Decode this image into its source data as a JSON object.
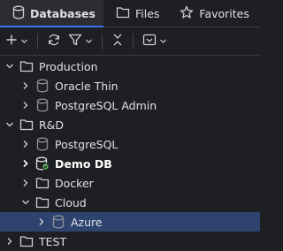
{
  "tabs": [
    {
      "label": "Databases",
      "icon": "database-icon",
      "active": true
    },
    {
      "label": "Files",
      "icon": "folder-icon",
      "active": false
    },
    {
      "label": "Favorites",
      "icon": "star-icon",
      "active": false
    }
  ],
  "toolbar": {
    "buttons": [
      "add-icon",
      "refresh-icon",
      "filter-icon",
      "collapse-all-icon",
      "view-options-icon"
    ]
  },
  "tree": [
    {
      "label": "Production",
      "icon": "folder-icon",
      "expanded": true,
      "depth": 0
    },
    {
      "label": "Oracle Thin",
      "icon": "database-icon",
      "expanded": false,
      "depth": 1
    },
    {
      "label": "PostgreSQL Admin",
      "icon": "database-icon",
      "expanded": false,
      "depth": 1
    },
    {
      "label": "R&D",
      "icon": "folder-icon",
      "expanded": true,
      "depth": 0
    },
    {
      "label": "PostgreSQL",
      "icon": "database-icon",
      "expanded": false,
      "depth": 1
    },
    {
      "label": "Demo DB",
      "icon": "database-connected-icon",
      "expanded": false,
      "depth": 1,
      "bold": true
    },
    {
      "label": "Docker",
      "icon": "folder-icon",
      "expanded": false,
      "depth": 1
    },
    {
      "label": "Cloud",
      "icon": "folder-icon",
      "expanded": true,
      "depth": 1
    },
    {
      "label": "Azure",
      "icon": "database-icon",
      "expanded": false,
      "depth": 2,
      "selected": true
    },
    {
      "label": "TEST",
      "icon": "folder-icon",
      "expanded": false,
      "depth": 0
    }
  ],
  "colors": {
    "background": "#1e1f22",
    "selection": "#2e436e",
    "accent": "#3574f0",
    "connected": "#5fb865"
  }
}
